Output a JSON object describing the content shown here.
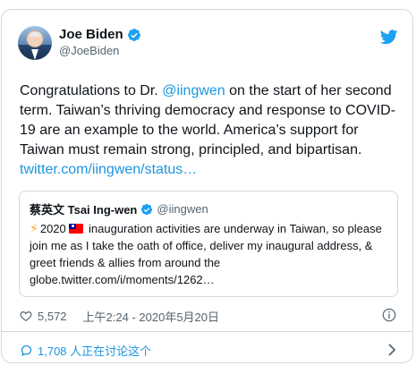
{
  "author": {
    "name": "Joe Biden",
    "handle": "@JoeBiden"
  },
  "tweet": {
    "text_prefix": "Congratulations to Dr. ",
    "mention": "@iingwen",
    "text_suffix": " on the start of her second term. Taiwan’s thriving democracy and response to COVID-19 are an example to the world. America’s support for Taiwan must remain strong, principled, and bipartisan.",
    "link": "twitter.com/iingwen/status…"
  },
  "quote": {
    "name": "蔡英文 Tsai Ing-wen",
    "handle": "@iingwen",
    "body": "2020  inauguration activities are underway in Taiwan, so please join me as I take the oath of office, deliver my inaugural address, & greet friends & allies from around the globe.twitter.com/i/moments/1262…",
    "body_lead": "2020",
    "body_rest": "inauguration activities are underway in Taiwan, so please join me as I take the oath of office, deliver my inaugural address, & greet friends & allies from around the globe.twitter.com/i/moments/1262…"
  },
  "meta": {
    "likes": "5,572",
    "timestamp": "上午2:24 - 2020年5月20日"
  },
  "footer": {
    "replies_label": "1,708 人正在讨论这个"
  },
  "colors": {
    "link": "#1b95e0",
    "text": "#0f1419",
    "secondary": "#536471",
    "border": "#cfd9de"
  },
  "icons": [
    "verified-badge-icon",
    "twitter-bird-icon",
    "heart-icon",
    "info-icon",
    "reply-bubble-icon",
    "chevron-right-icon",
    "lightning-emoji-icon",
    "taiwan-flag-icon"
  ]
}
